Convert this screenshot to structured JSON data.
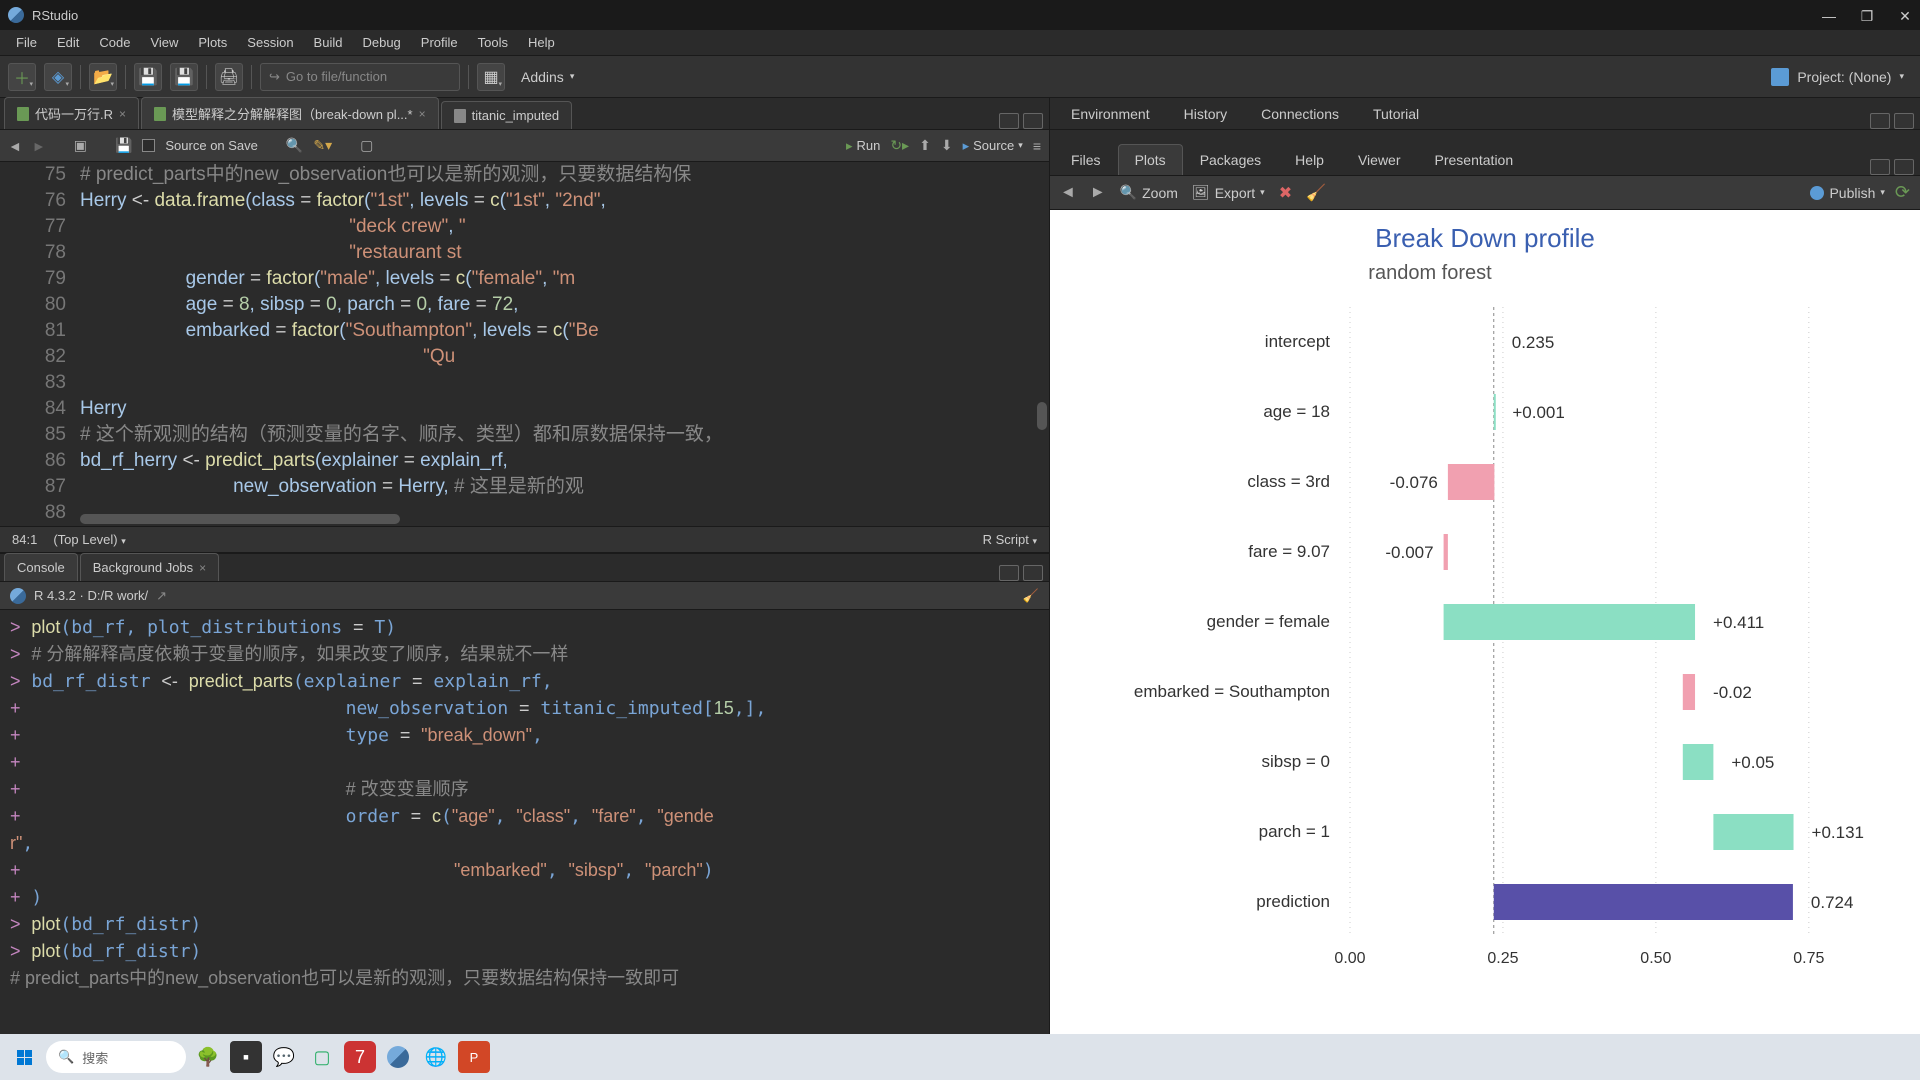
{
  "title": "RStudio",
  "menu": [
    "File",
    "Edit",
    "Code",
    "View",
    "Plots",
    "Session",
    "Build",
    "Debug",
    "Profile",
    "Tools",
    "Help"
  ],
  "toolbar": {
    "goto": "Go to file/function",
    "addins": "Addins",
    "project": "Project: (None)"
  },
  "editor": {
    "tabs": [
      {
        "label": "代码一万行.R",
        "icon": "r"
      },
      {
        "label": "模型解释之分解解释图（break-down pl...*",
        "icon": "r"
      },
      {
        "label": "titanic_imputed",
        "icon": "table"
      }
    ],
    "sourceOnSave": "Source on Save",
    "run": "Run",
    "source": "Source",
    "status_pos": "84:1",
    "status_scope": "(Top Level)",
    "status_type": "R Script",
    "gutter": [
      "75",
      "76",
      "77",
      "78",
      "79",
      "80",
      "81",
      "82",
      "83",
      "84",
      "85",
      "86",
      "87",
      "88"
    ]
  },
  "console": {
    "tabs": [
      "Console",
      "Background Jobs"
    ],
    "info": "R 4.3.2 · D:/R work/"
  },
  "env_tabs": [
    "Environment",
    "History",
    "Connections",
    "Tutorial"
  ],
  "plot_tabs": [
    "Files",
    "Plots",
    "Packages",
    "Help",
    "Viewer",
    "Presentation"
  ],
  "plot_toolbar": {
    "zoom": "Zoom",
    "export": "Export",
    "publish": "Publish"
  },
  "search_placeholder": "搜索",
  "chart_data": {
    "type": "bar",
    "title": "Break Down profile",
    "subtitle": "random forest",
    "baseline": 0.235,
    "xticks": [
      0.0,
      0.25,
      0.5,
      0.75
    ],
    "rows": [
      {
        "label": "intercept",
        "value": "0.235",
        "start": 0.235,
        "end": 0.235,
        "color": "none"
      },
      {
        "label": "age = 18",
        "value": "+0.001",
        "start": 0.235,
        "end": 0.236,
        "color": "pos"
      },
      {
        "label": "class = 3rd",
        "value": "-0.076",
        "start": 0.236,
        "end": 0.16,
        "color": "neg"
      },
      {
        "label": "fare = 9.07",
        "value": "-0.007",
        "start": 0.16,
        "end": 0.153,
        "color": "neg"
      },
      {
        "label": "gender = female",
        "value": "+0.411",
        "start": 0.153,
        "end": 0.564,
        "color": "pos"
      },
      {
        "label": "embarked = Southampton",
        "value": "-0.02",
        "start": 0.564,
        "end": 0.544,
        "color": "neg"
      },
      {
        "label": "sibsp = 0",
        "value": "+0.05",
        "start": 0.544,
        "end": 0.594,
        "color": "pos"
      },
      {
        "label": "parch = 1",
        "value": "+0.131",
        "start": 0.594,
        "end": 0.725,
        "color": "pos"
      },
      {
        "label": "prediction",
        "value": "0.724",
        "start": 0.235,
        "end": 0.724,
        "color": "pred"
      }
    ]
  }
}
